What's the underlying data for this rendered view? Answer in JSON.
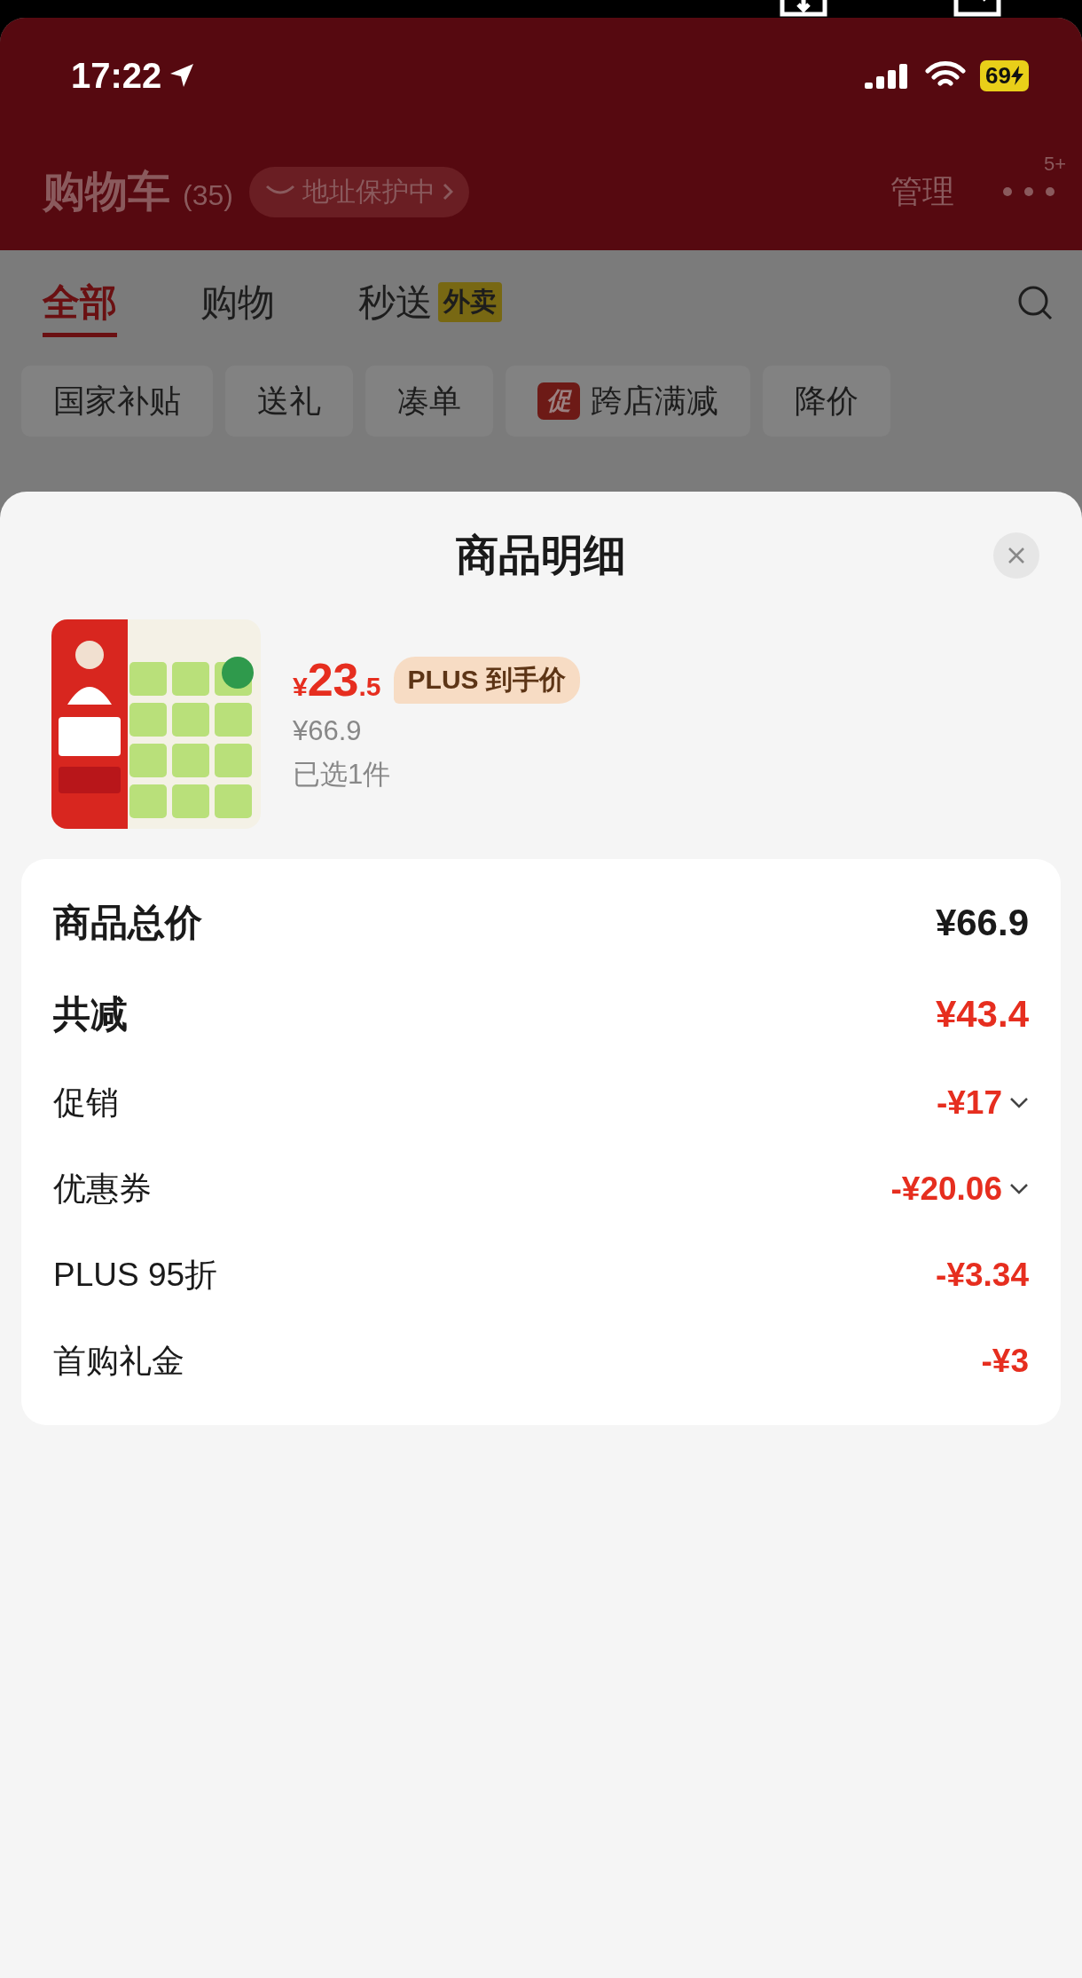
{
  "status_bar": {
    "time": "17:22",
    "battery": "69"
  },
  "header": {
    "title": "购物车",
    "count": "(35)",
    "address_badge": "地址保护中",
    "manage": "管理",
    "more_badge": "5+"
  },
  "tabs": [
    {
      "label": "全部",
      "selected": true
    },
    {
      "label": "购物",
      "selected": false
    },
    {
      "label": "秒送",
      "selected": false,
      "tag": "外卖"
    }
  ],
  "filters": [
    {
      "label": "国家补贴"
    },
    {
      "label": "送礼"
    },
    {
      "label": "凑单"
    },
    {
      "label": "跨店满减",
      "promo_tag": "促"
    },
    {
      "label": "降价"
    }
  ],
  "sheet": {
    "title": "商品明细",
    "product": {
      "kind": "picture",
      "currency": "¥",
      "price_integer": "23",
      "price_decimal": ".5",
      "plus_tag": "PLUS 到手价",
      "original_price": "¥66.9",
      "selected_count": "已选1件"
    },
    "rows": [
      {
        "kind": "total",
        "label": "商品总价",
        "value": "¥66.9",
        "expandable": false
      },
      {
        "kind": "reduction",
        "label": "共减",
        "value": "¥43.4",
        "expandable": false
      },
      {
        "kind": "detail",
        "label": "促销",
        "value": "-¥17",
        "expandable": true
      },
      {
        "kind": "detail",
        "label": "优惠券",
        "value": "-¥20.06",
        "expandable": true
      },
      {
        "kind": "detail",
        "label": "PLUS 95折",
        "value": "-¥3.34",
        "expandable": false
      },
      {
        "kind": "detail",
        "label": "首购礼金",
        "value": "-¥3",
        "expandable": false
      }
    ]
  }
}
